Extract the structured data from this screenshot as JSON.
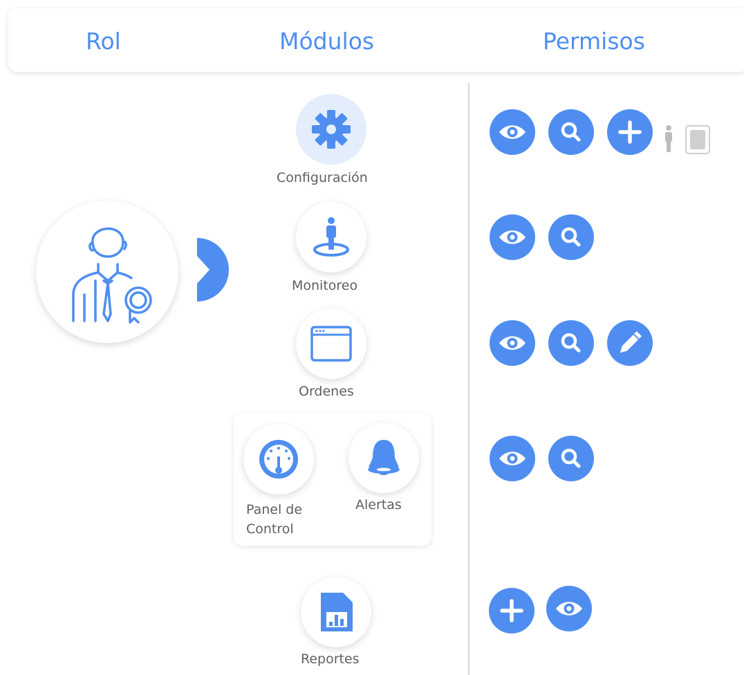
{
  "header": {
    "tabs": [
      {
        "label": "Rol"
      },
      {
        "label": "Módulos"
      },
      {
        "label": "Permisos"
      }
    ]
  },
  "role": {
    "icon": "user-badge-icon"
  },
  "modules": [
    {
      "label": "Configuración",
      "icon": "gear-icon",
      "active": true
    },
    {
      "label": "Monitoreo",
      "icon": "person-location-icon"
    },
    {
      "label": "Ordenes",
      "icon": "browser-window-icon"
    },
    {
      "label": "Panel de Control",
      "icon": "dashboard-gauge-icon"
    },
    {
      "label": "Alertas",
      "icon": "bell-icon"
    },
    {
      "label": "Reportes",
      "icon": "report-chart-icon"
    }
  ],
  "permissions": [
    {
      "row": "Configuración",
      "icons": [
        "eye-icon",
        "search-icon",
        "plus-icon"
      ]
    },
    {
      "row": "Monitoreo",
      "icons": [
        "eye-icon",
        "search-icon"
      ]
    },
    {
      "row": "Ordenes",
      "icons": [
        "eye-icon",
        "search-icon",
        "pencil-icon"
      ]
    },
    {
      "row": "Panel de Control / Alertas",
      "icons": [
        "eye-icon",
        "search-icon"
      ]
    },
    {
      "row": "Reportes",
      "icons": [
        "plus-icon",
        "eye-icon"
      ]
    }
  ],
  "colors": {
    "accent": "#4f8ef0",
    "active_bg": "#e3edfb",
    "text": "#5f5f5f"
  }
}
